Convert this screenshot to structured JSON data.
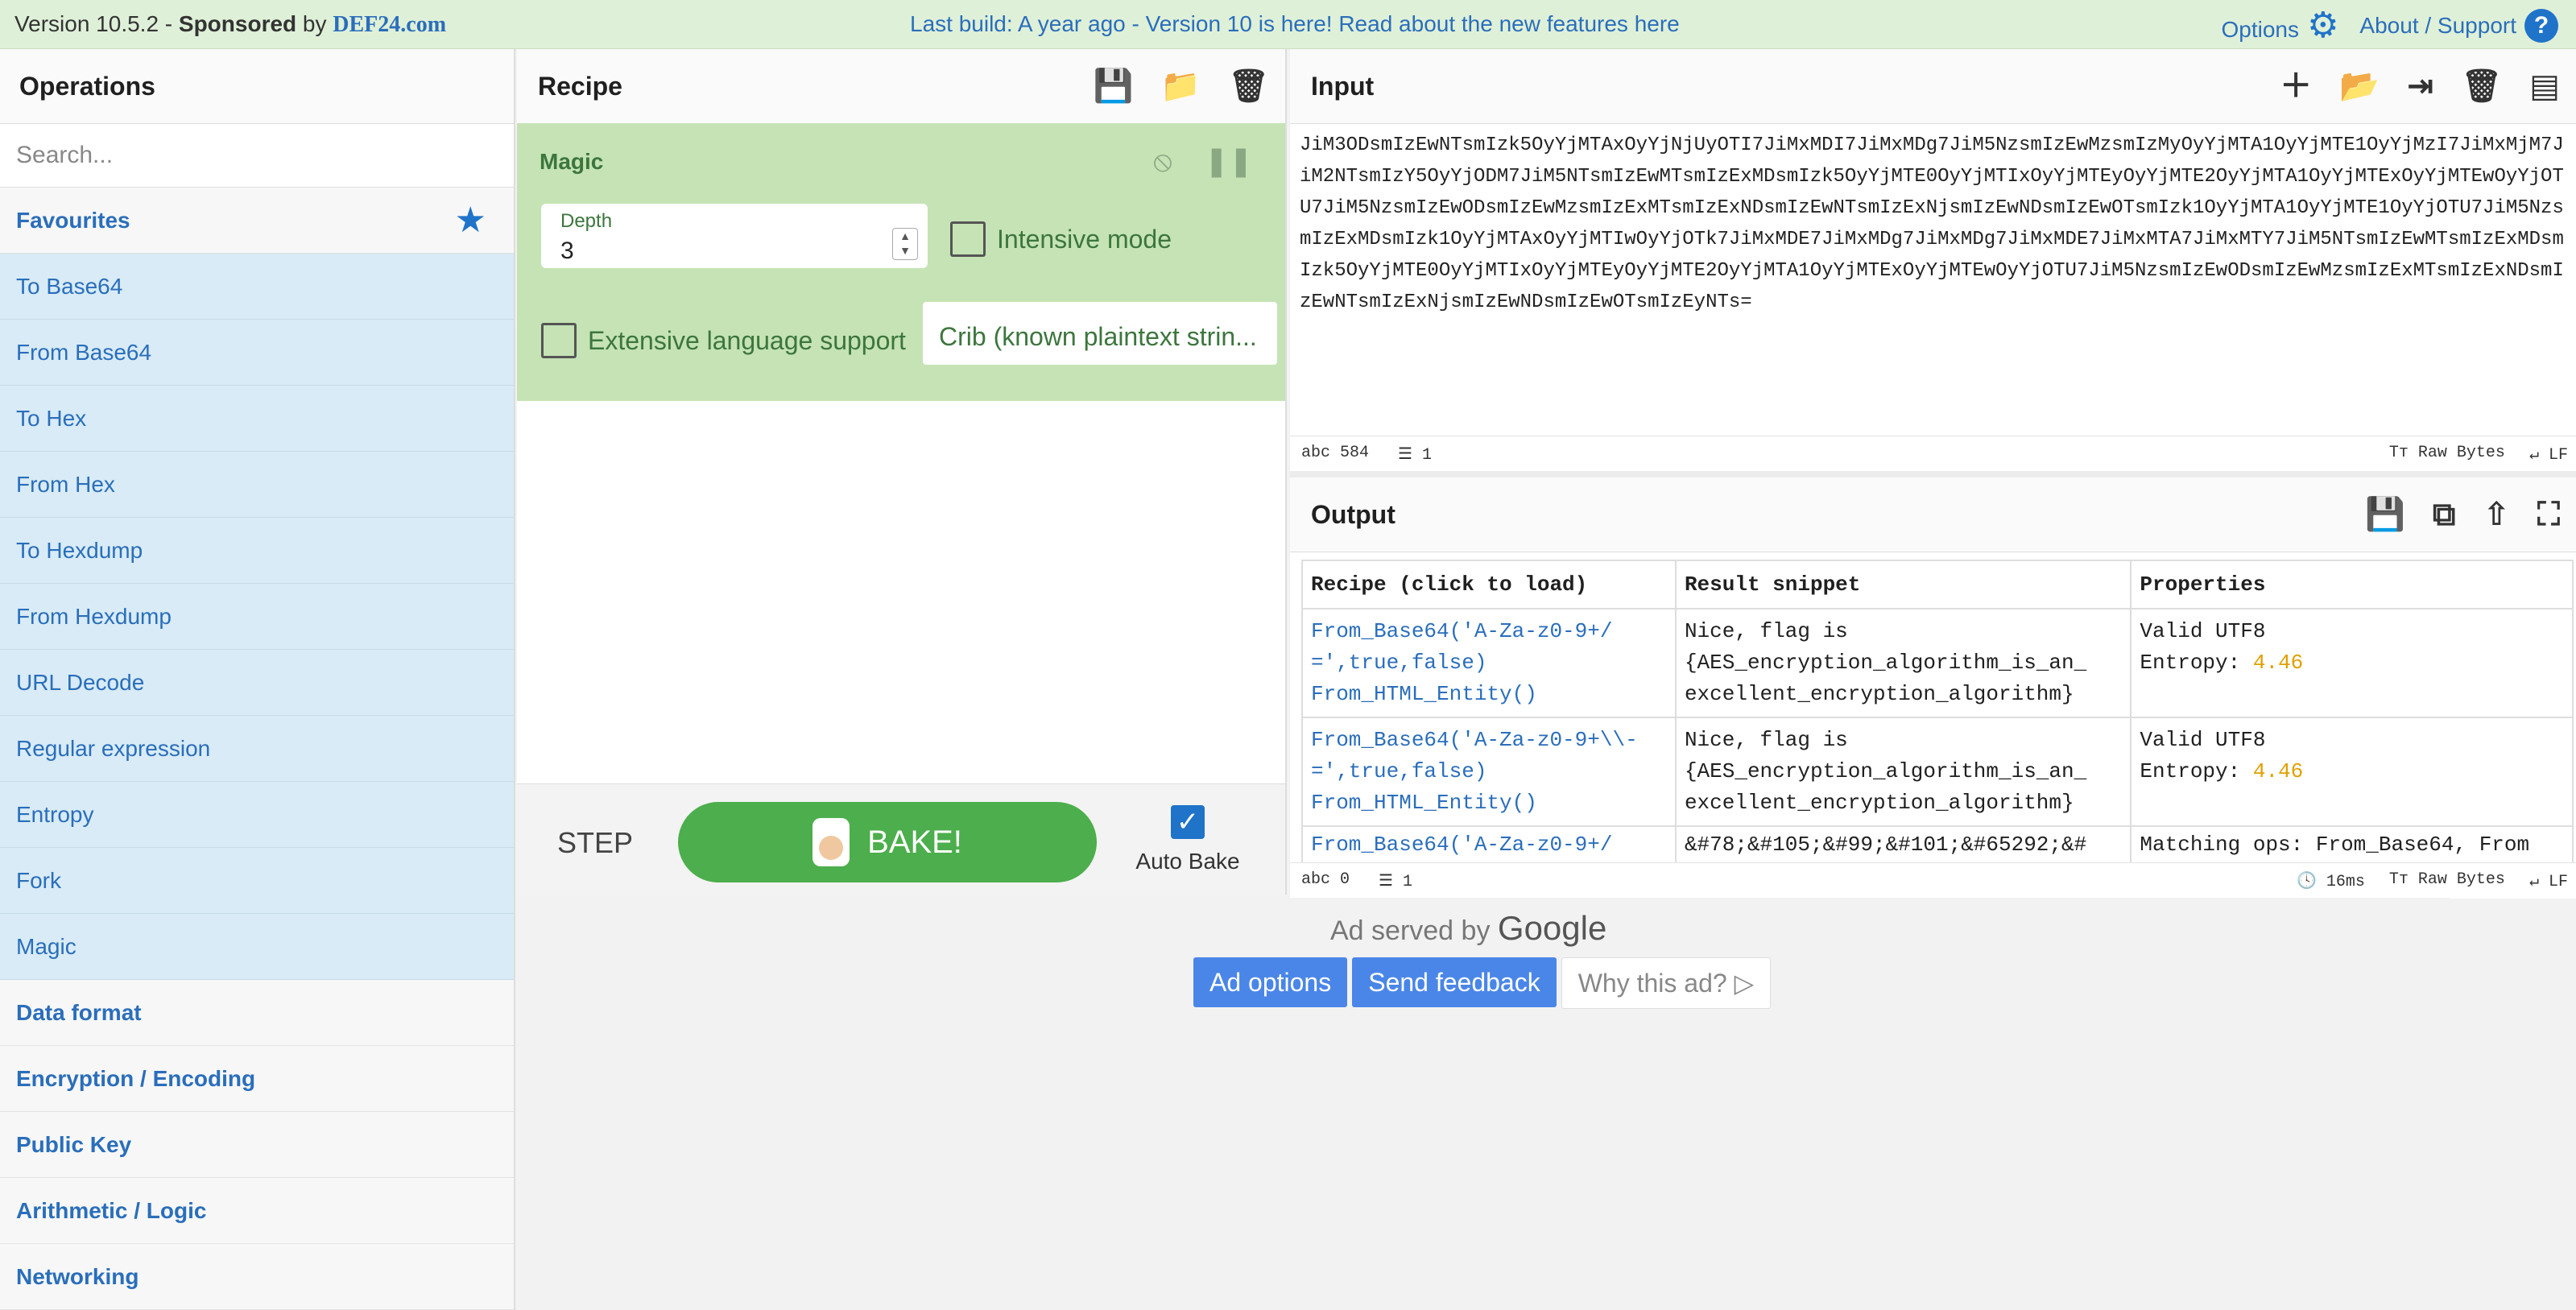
{
  "banner": {
    "version": "Version 10.5.2 - ",
    "sponsored": "Sponsored",
    "by": " by ",
    "sponsor": "DEF24.com",
    "notice": "Last build: A year ago - Version 10 is here! Read about the new features here",
    "options": "Options",
    "about": "About / Support"
  },
  "operations": {
    "title": "Operations",
    "search_placeholder": "Search...",
    "favourites": "Favourites",
    "items": [
      "To Base64",
      "From Base64",
      "To Hex",
      "From Hex",
      "To Hexdump",
      "From Hexdump",
      "URL Decode",
      "Regular expression",
      "Entropy",
      "Fork",
      "Magic"
    ],
    "categories": [
      "Data format",
      "Encryption / Encoding",
      "Public Key",
      "Arithmetic / Logic",
      "Networking"
    ]
  },
  "recipe": {
    "title": "Recipe",
    "operation": "Magic",
    "depth_label": "Depth",
    "depth_value": "3",
    "intensive": "Intensive mode",
    "extensive": "Extensive language support",
    "crib": "Crib (known plaintext strin...",
    "step": "STEP",
    "bake": "BAKE!",
    "auto_bake": "Auto Bake"
  },
  "input": {
    "title": "Input",
    "text": "JiM3ODsmIzEwNTsmIzk5OyYjMTAxOyYjNjUyOTI7JiMxMDI7JiMxMDg7JiM5NzsmIzEwMzsmIzMyOyYjMTA1OyYjMTE1OyYjMzI7JiMxMjM7JiM2NTsmIzY5OyYjODM7JiM5NTsmIzEwMTsmIzExMDsmIzk5OyYjMTE0OyYjMTIxOyYjMTEyOyYjMTE2OyYjMTA1OyYjMTExOyYjMTEwOyYjOTU7JiM5NzsmIzEwODsmIzEwMzsmIzExMTsmIzExNDsmIzEwNTsmIzExNjsmIzEwNDsmIzEwOTsmIzk1OyYjMTA1OyYjMTE1OyYjOTU7JiM5NzsmIzExMDsmIzk1OyYjMTAxOyYjMTIwOyYjOTk7JiMxMDE7JiMxMDg7JiMxMDg7JiMxMDE7JiMxMTA7JiMxMTY7JiM5NTsmIzEwMTsmIzExMDsmIzk5OyYjMTE0OyYjMTIxOyYjMTEyOyYjMTE2OyYjMTA1OyYjMTExOyYjMTEwOyYjOTU7JiM5NzsmIzEwODsmIzEwMzsmIzExMTsmIzExNDsmIzEwNTsmIzExNjsmIzEwNDsmIzEwOTsmIzEyNTs=",
    "length": "584",
    "lines": "1",
    "encoding": "Raw Bytes",
    "eol": "LF"
  },
  "output": {
    "title": "Output",
    "headers": [
      "Recipe (click to load)",
      "Result snippet",
      "Properties"
    ],
    "rows": [
      {
        "recipe": "From_Base64('A-Za-z0-9+/\n=',true,false)\nFrom_HTML_Entity()",
        "result": "Nice, flag is\n{AES_encryption_algorithm_is_an_\nexcellent_encryption_algorithm}",
        "prop1": "Valid UTF8",
        "prop_label": "Entropy: ",
        "entropy": "4.46"
      },
      {
        "recipe": "From_Base64('A-Za-z0-9+\\\\-\n=',true,false)\nFrom_HTML_Entity()",
        "result": "Nice, flag is\n{AES_encryption_algorithm_is_an_\nexcellent_encryption_algorithm}",
        "prop1": "Valid UTF8",
        "prop_label": "Entropy: ",
        "entropy": "4.46"
      },
      {
        "recipe": "From_Base64('A-Za-z0-9+/",
        "result": "&#78;&#105;&#99;&#101;&#65292;&#",
        "prop1": "Matching ops: From_Base64, From",
        "prop_label": "",
        "entropy": ""
      }
    ],
    "length": "0",
    "lines": "1",
    "time": "16ms",
    "encoding": "Raw Bytes",
    "eol": "LF"
  },
  "ad": {
    "served_by": "Ad served by",
    "google": "Google",
    "options": "Ad options",
    "feedback": "Send feedback",
    "why": "Why this ad?"
  },
  "colors": {
    "accent": "#2a6ebb",
    "favourite_bg": "#d8ebf6",
    "recipe_op_bg": "#c5e3b5",
    "bake_green": "#4cae4c",
    "banner_bg": "#dff0d8",
    "entropy": "#e0a000"
  }
}
